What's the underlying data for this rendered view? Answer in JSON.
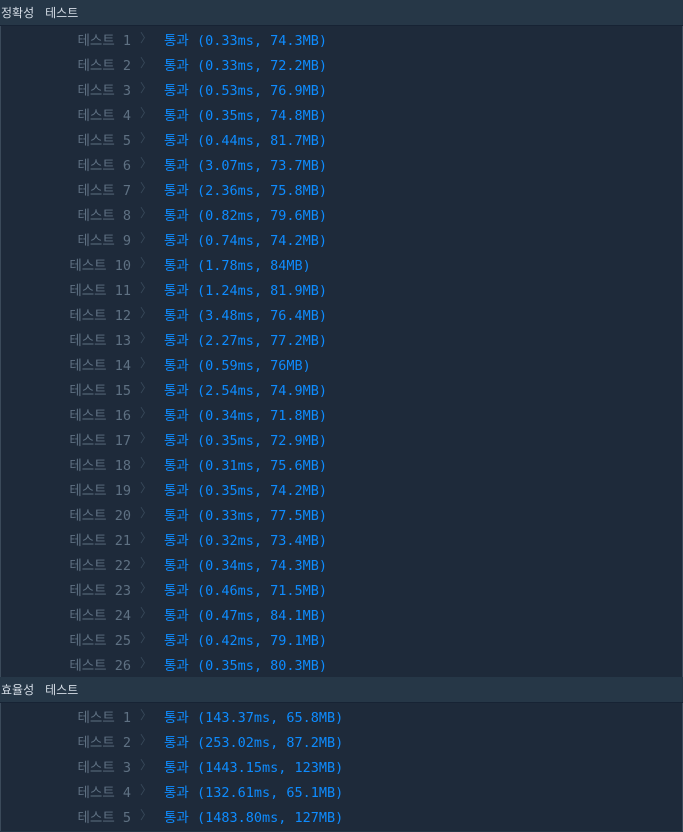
{
  "accuracy": {
    "title": "정확성",
    "subtitle": "테스트",
    "tests": [
      {
        "label": "테스트 1",
        "result": "통과 (0.33ms, 74.3MB)"
      },
      {
        "label": "테스트 2",
        "result": "통과 (0.33ms, 72.2MB)"
      },
      {
        "label": "테스트 3",
        "result": "통과 (0.53ms, 76.9MB)"
      },
      {
        "label": "테스트 4",
        "result": "통과 (0.35ms, 74.8MB)"
      },
      {
        "label": "테스트 5",
        "result": "통과 (0.44ms, 81.7MB)"
      },
      {
        "label": "테스트 6",
        "result": "통과 (3.07ms, 73.7MB)"
      },
      {
        "label": "테스트 7",
        "result": "통과 (2.36ms, 75.8MB)"
      },
      {
        "label": "테스트 8",
        "result": "통과 (0.82ms, 79.6MB)"
      },
      {
        "label": "테스트 9",
        "result": "통과 (0.74ms, 74.2MB)"
      },
      {
        "label": "테스트 10",
        "result": "통과 (1.78ms, 84MB)"
      },
      {
        "label": "테스트 11",
        "result": "통과 (1.24ms, 81.9MB)"
      },
      {
        "label": "테스트 12",
        "result": "통과 (3.48ms, 76.4MB)"
      },
      {
        "label": "테스트 13",
        "result": "통과 (2.27ms, 77.2MB)"
      },
      {
        "label": "테스트 14",
        "result": "통과 (0.59ms, 76MB)"
      },
      {
        "label": "테스트 15",
        "result": "통과 (2.54ms, 74.9MB)"
      },
      {
        "label": "테스트 16",
        "result": "통과 (0.34ms, 71.8MB)"
      },
      {
        "label": "테스트 17",
        "result": "통과 (0.35ms, 72.9MB)"
      },
      {
        "label": "테스트 18",
        "result": "통과 (0.31ms, 75.6MB)"
      },
      {
        "label": "테스트 19",
        "result": "통과 (0.35ms, 74.2MB)"
      },
      {
        "label": "테스트 20",
        "result": "통과 (0.33ms, 77.5MB)"
      },
      {
        "label": "테스트 21",
        "result": "통과 (0.32ms, 73.4MB)"
      },
      {
        "label": "테스트 22",
        "result": "통과 (0.34ms, 74.3MB)"
      },
      {
        "label": "테스트 23",
        "result": "통과 (0.46ms, 71.5MB)"
      },
      {
        "label": "테스트 24",
        "result": "통과 (0.47ms, 84.1MB)"
      },
      {
        "label": "테스트 25",
        "result": "통과 (0.42ms, 79.1MB)"
      },
      {
        "label": "테스트 26",
        "result": "통과 (0.35ms, 80.3MB)"
      }
    ]
  },
  "efficiency": {
    "title": "효율성",
    "subtitle": "테스트",
    "tests": [
      {
        "label": "테스트 1",
        "result": "통과 (143.37ms, 65.8MB)"
      },
      {
        "label": "테스트 2",
        "result": "통과 (253.02ms, 87.2MB)"
      },
      {
        "label": "테스트 3",
        "result": "통과 (1443.15ms, 123MB)"
      },
      {
        "label": "테스트 4",
        "result": "통과 (132.61ms, 65.1MB)"
      },
      {
        "label": "테스트 5",
        "result": "통과 (1483.80ms, 127MB)"
      }
    ]
  },
  "icons": {
    "row_separator": "chevron-right-icon"
  },
  "colors": {
    "background": "#1e2a3a",
    "header_background": "#263747",
    "label": "#5f7183",
    "pass": "#0e8cff",
    "header_text": "#d5dde6"
  }
}
